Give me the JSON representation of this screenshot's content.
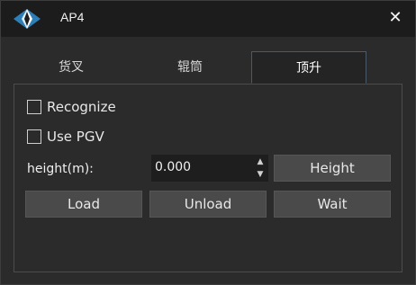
{
  "window": {
    "title": "AP4",
    "close_glyph": "✕",
    "icon": "diamond-logo-icon",
    "accent_color": "#3a9bd5"
  },
  "tabs": [
    {
      "label": "货叉",
      "active": false
    },
    {
      "label": "辊筒",
      "active": false
    },
    {
      "label": "顶升",
      "active": true
    }
  ],
  "panel": {
    "recognize": {
      "label": "Recognize",
      "checked": false
    },
    "use_pgv": {
      "label": "Use PGV",
      "checked": false
    },
    "height_label": "height(m):",
    "height_value": "0.000",
    "height_button": "Height",
    "load_button": "Load",
    "unload_button": "Unload",
    "wait_button": "Wait"
  }
}
